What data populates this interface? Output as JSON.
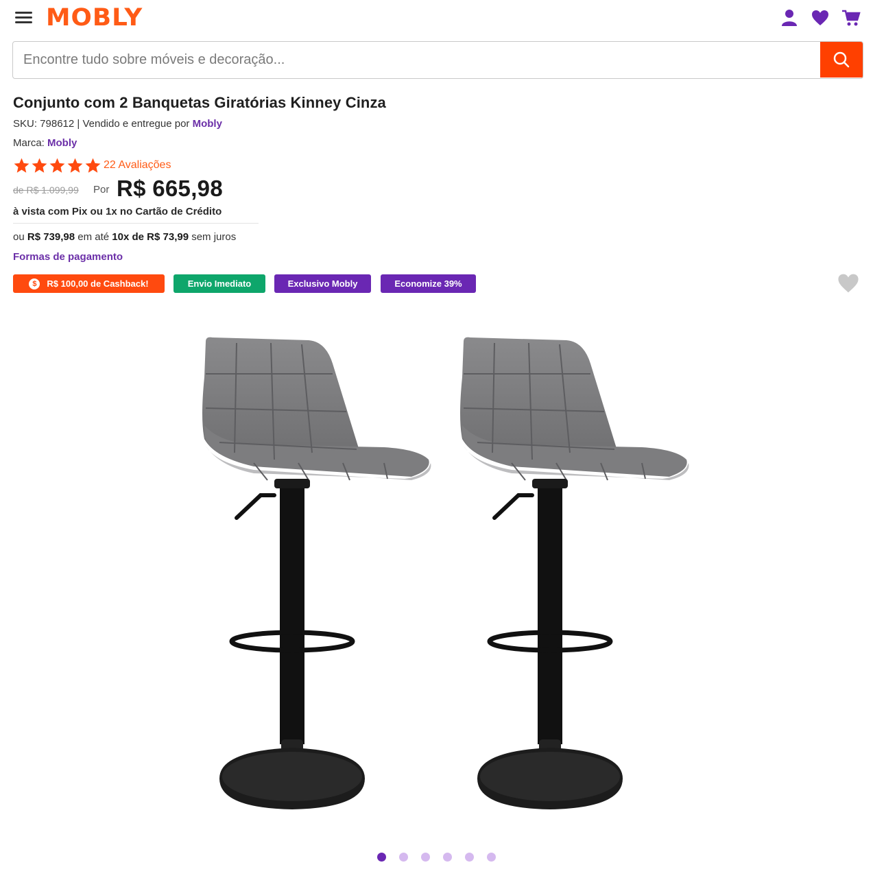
{
  "header": {
    "logo": "MOBLY",
    "icons": [
      "menu-icon",
      "user-icon",
      "heart-icon",
      "cart-icon"
    ]
  },
  "search": {
    "placeholder": "Encontre tudo sobre móveis e decoração..."
  },
  "product": {
    "title": "Conjunto com 2 Banquetas Giratórias Kinney Cinza",
    "sku_prefix": "SKU: 798612 | Vendido e entregue por ",
    "seller": "Mobly",
    "brand_label": "Marca: ",
    "brand": "Mobly",
    "rating_stars": 5,
    "reviews": "22 Avaliações"
  },
  "pricing": {
    "old_price": "de R$ 1.099,99",
    "por": "Por",
    "price": "R$ 665,98",
    "pix_note": "à vista com Pix ou 1x no Cartão de Crédito",
    "install_prefix": "ou ",
    "install_total": "R$ 739,98",
    "install_mid": " em até ",
    "install_parcels": "10x de R$ 73,99",
    "install_suffix": " sem juros",
    "payment_link": "Formas de pagamento"
  },
  "badges": {
    "cashback_coin": "$",
    "cashback": "R$ 100,00 de Cashback!",
    "envio": "Envio Imediato",
    "exclusivo": "Exclusivo Mobly",
    "economize": "Economize 39%"
  },
  "gallery": {
    "total_images": 6,
    "active_index": 0
  },
  "colors": {
    "brand_orange": "#ff5b16",
    "search_button": "#ff4000",
    "purple": "#6a27b3",
    "green": "#0ea66b"
  }
}
